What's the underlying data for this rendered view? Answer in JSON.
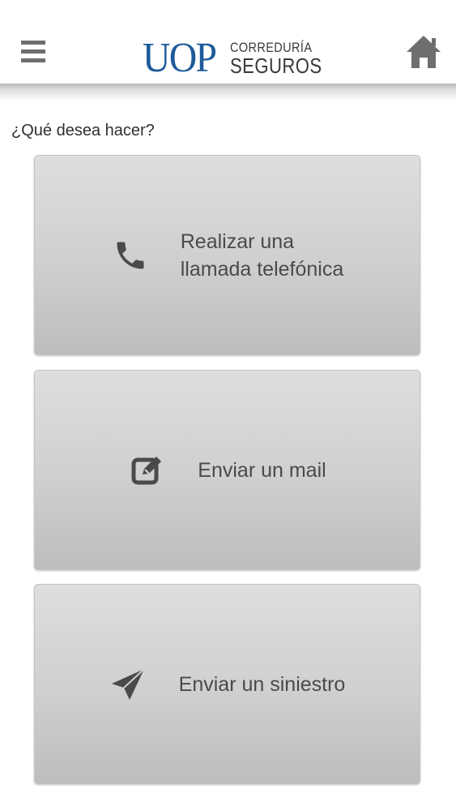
{
  "header": {
    "menu_icon": "hamburger-menu-icon",
    "logo": {
      "mark": "UOP",
      "line1": "CORREDURÍA",
      "line2": "SEGUROS",
      "color": "#1e5a9a"
    },
    "home_icon": "home-icon"
  },
  "main": {
    "question": "¿Qué desea hacer?",
    "actions": [
      {
        "icon": "phone-icon",
        "label_line1": "Realizar una",
        "label_line2": "llamada telefónica"
      },
      {
        "icon": "edit-icon",
        "label": "Enviar un mail"
      },
      {
        "icon": "send-icon",
        "label": "Enviar un siniestro"
      }
    ]
  },
  "colors": {
    "icon_gray": "#6e6e6e",
    "card_text": "#4a4a4a",
    "brand_blue": "#1e5a9a"
  }
}
